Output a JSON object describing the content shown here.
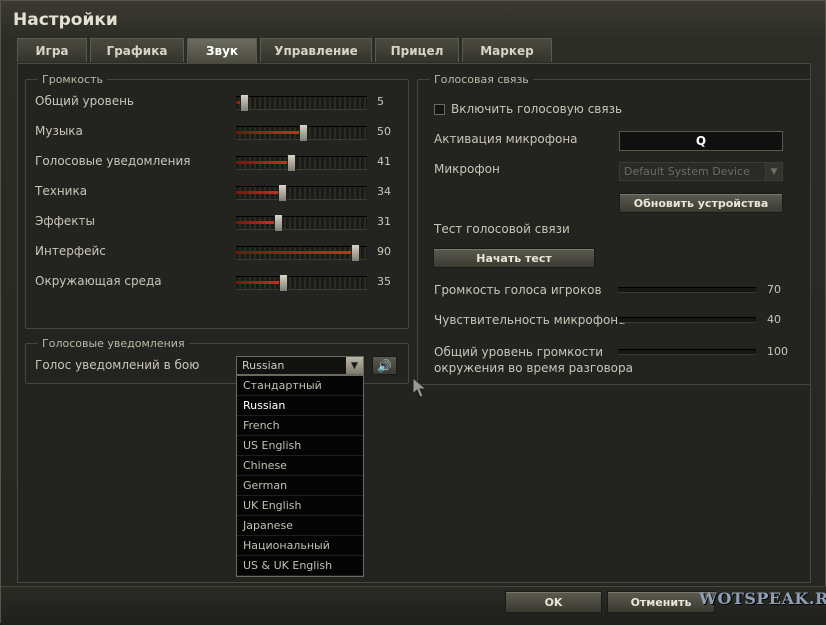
{
  "window": {
    "title": "Настройки"
  },
  "tabs": [
    {
      "label": "Игра",
      "active": false
    },
    {
      "label": "Графика",
      "active": false
    },
    {
      "label": "Звук",
      "active": true
    },
    {
      "label": "Управление",
      "active": false
    },
    {
      "label": "Прицел",
      "active": false
    },
    {
      "label": "Маркер",
      "active": false
    }
  ],
  "volume": {
    "legend": "Громкость",
    "items": [
      {
        "label": "Общий уровень",
        "value": 5
      },
      {
        "label": "Музыка",
        "value": 50
      },
      {
        "label": "Голосовые уведомления",
        "value": 41
      },
      {
        "label": "Техника",
        "value": 34
      },
      {
        "label": "Эффекты",
        "value": 31
      },
      {
        "label": "Интерфейс",
        "value": 90
      },
      {
        "label": "Окружающая среда",
        "value": 35
      }
    ]
  },
  "voice_notifications": {
    "legend": "Голосовые уведомления",
    "label": "Голос уведомлений в бою",
    "selected": "Russian",
    "options": [
      "Стандартный",
      "Russian",
      "French",
      "US English",
      "Chinese",
      "German",
      "UK English",
      "Japanese",
      "Национальный",
      "US & UK English"
    ]
  },
  "voice_chat": {
    "legend": "Голосовая связь",
    "enable_label": "Включить голосовую связь",
    "enabled": false,
    "mic_activation_label": "Активация микрофона",
    "mic_activation_key": "Q",
    "mic_label": "Микрофон",
    "mic_device": "Default System Device",
    "refresh_button": "Обновить устройства",
    "test_label": "Тест голосовой связи",
    "test_button": "Начать тест",
    "levels": [
      {
        "label": "Громкость голоса игроков",
        "value": 70
      },
      {
        "label": "Чувствительность микрофона",
        "value": 40
      },
      {
        "label": "Общий уровень громкости\nокружения во время разговора",
        "value": 100
      }
    ]
  },
  "footer": {
    "ok_button": "OK",
    "cancel_button": "Отменить",
    "watermark": "WOTSPEAK.RU"
  },
  "colors": {
    "accent_red": "#c23524",
    "panel_bg": "#232320"
  }
}
